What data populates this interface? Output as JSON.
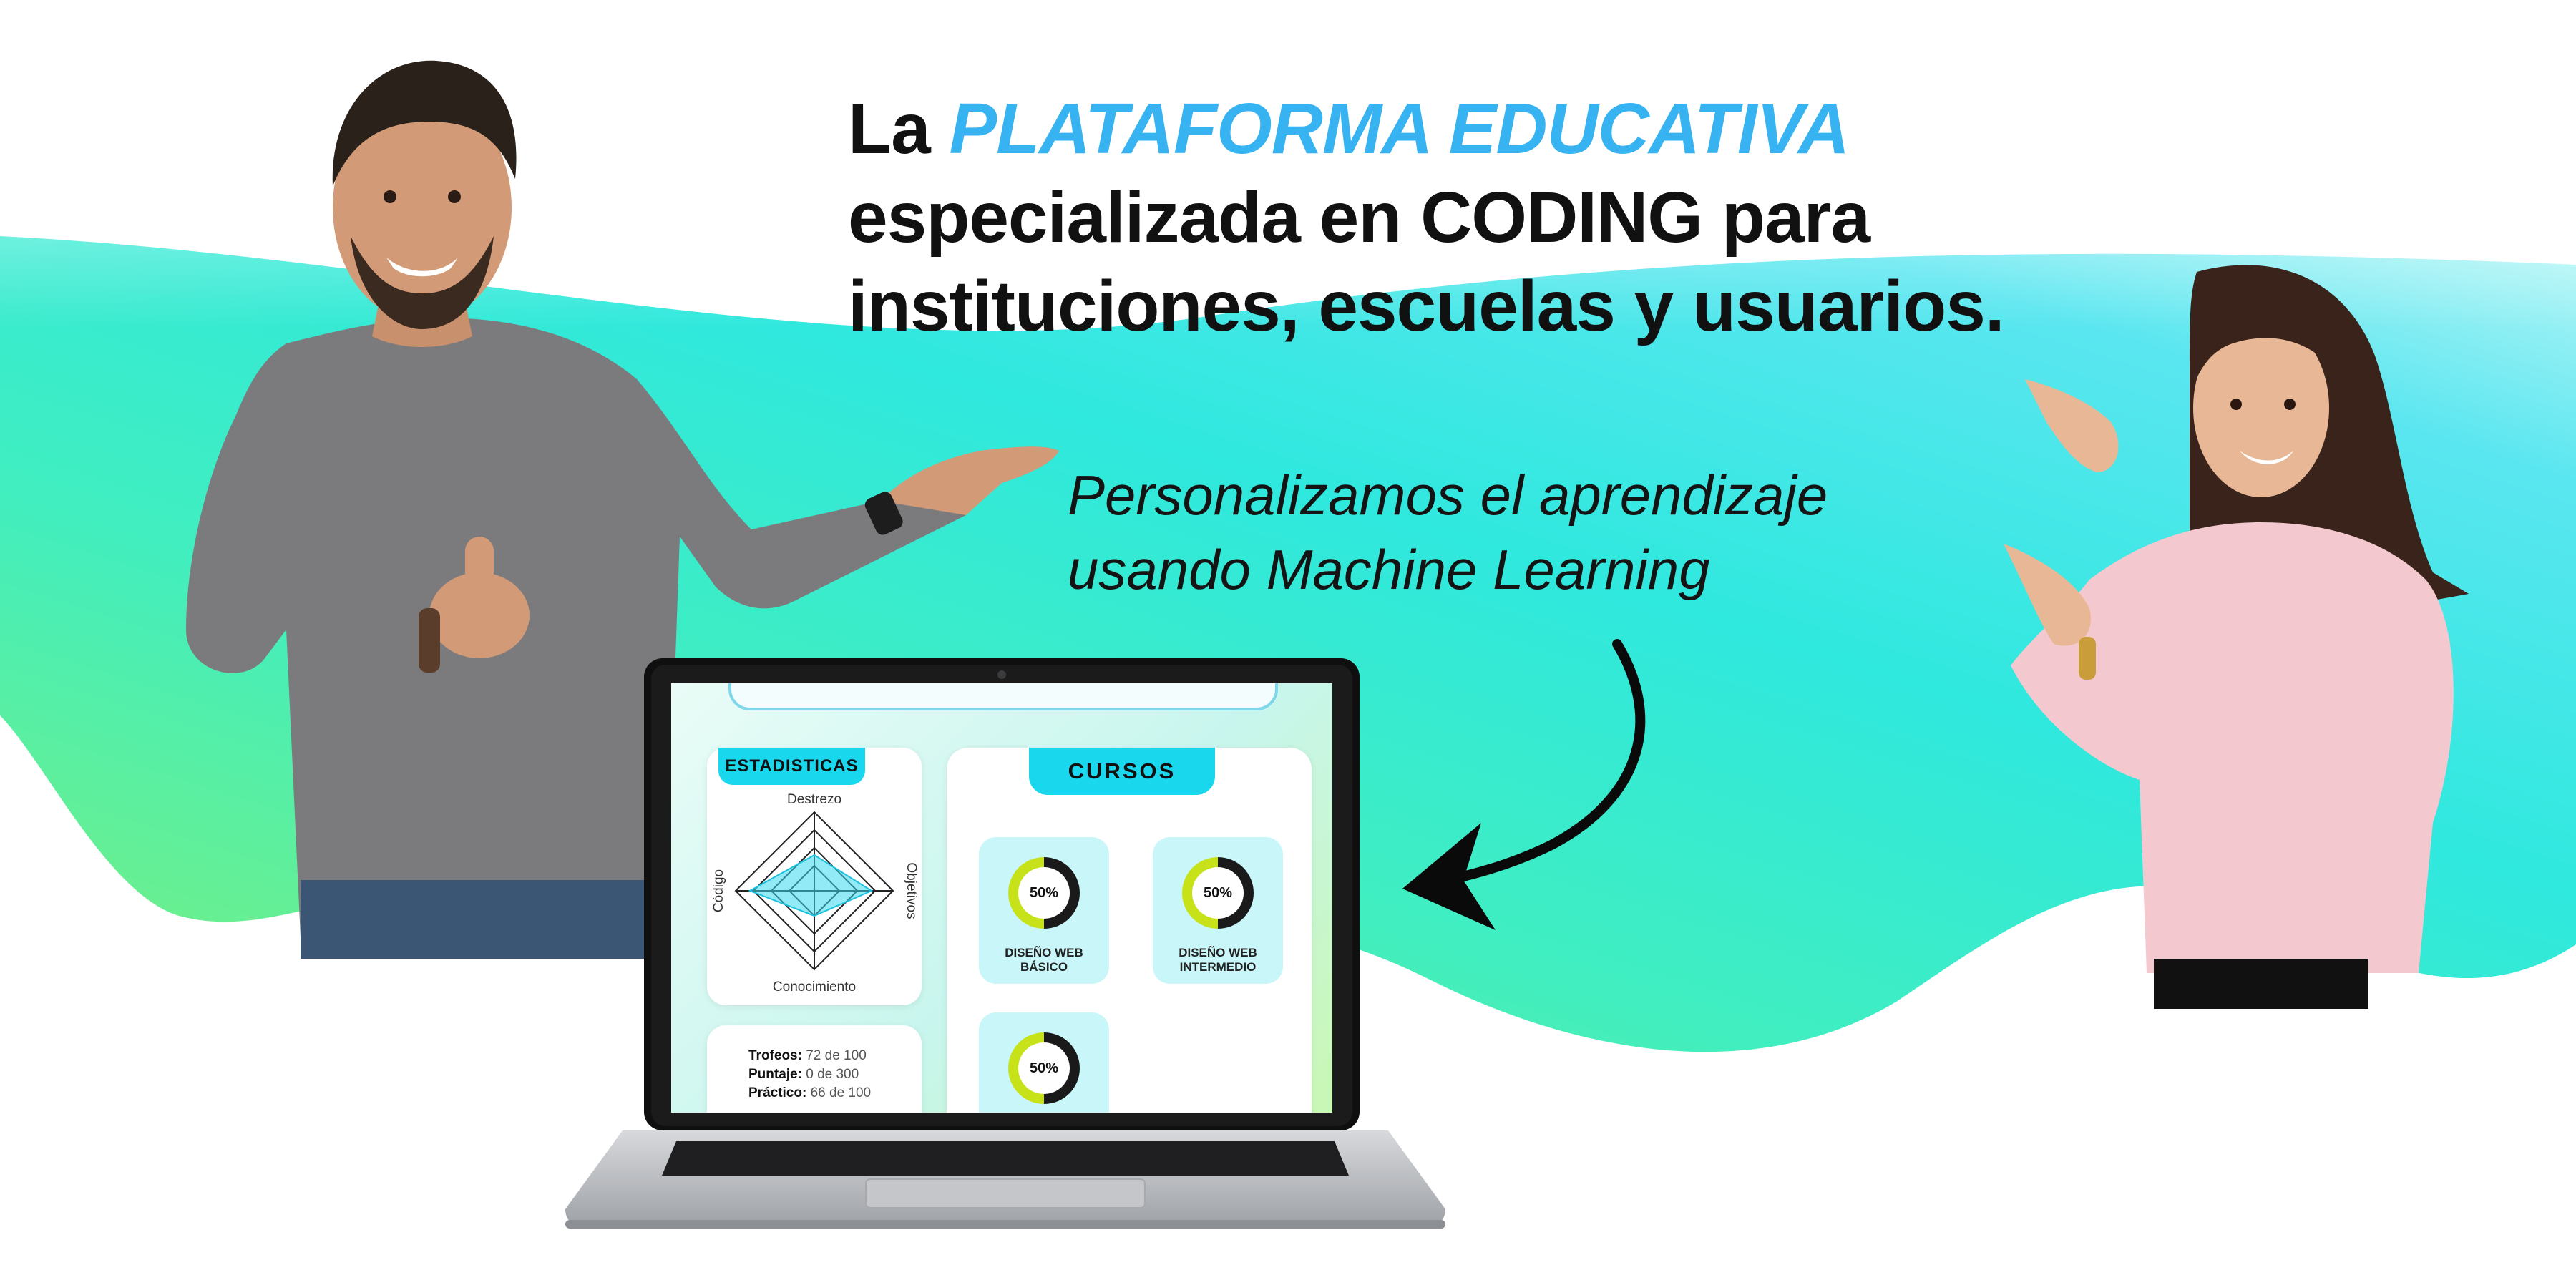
{
  "hero": {
    "line1_prefix": "La ",
    "line1_highlight": "PLATAFORMA EDUCATIVA",
    "line2": "especializada en CODING para",
    "line3": "instituciones, escuelas y usuarios.",
    "subtitle_line1": "Personalizamos el aprendizaje",
    "subtitle_line2": "usando Machine Learning"
  },
  "laptop_screen": {
    "stats_tab": "ESTADISTICAS",
    "courses_tab": "CURSOS",
    "radar_labels": {
      "top": "Destrezo",
      "bottom": "Conocimiento",
      "left": "Código",
      "right": "Objetivos"
    },
    "metrics": [
      {
        "label": "Trofeos:",
        "value": "72 de 100"
      },
      {
        "label": "Puntaje:",
        "value": "0 de 300"
      },
      {
        "label": "Práctico:",
        "value": "66 de 100"
      }
    ],
    "courses": [
      {
        "percent_label": "50%",
        "progress": 0.5,
        "name_line1": "DISEÑO WEB",
        "name_line2": "BÁSICO"
      },
      {
        "percent_label": "50%",
        "progress": 0.5,
        "name_line1": "DISEÑO WEB",
        "name_line2": "INTERMEDIO"
      },
      {
        "percent_label": "50%",
        "progress": 0.5,
        "name_line1": "",
        "name_line2": ""
      }
    ]
  },
  "colors": {
    "highlight": "#38b3f2",
    "cyan_tab": "#19d8ee",
    "ring_dark": "#1a1a1a",
    "ring_lime": "#c8e21a"
  }
}
